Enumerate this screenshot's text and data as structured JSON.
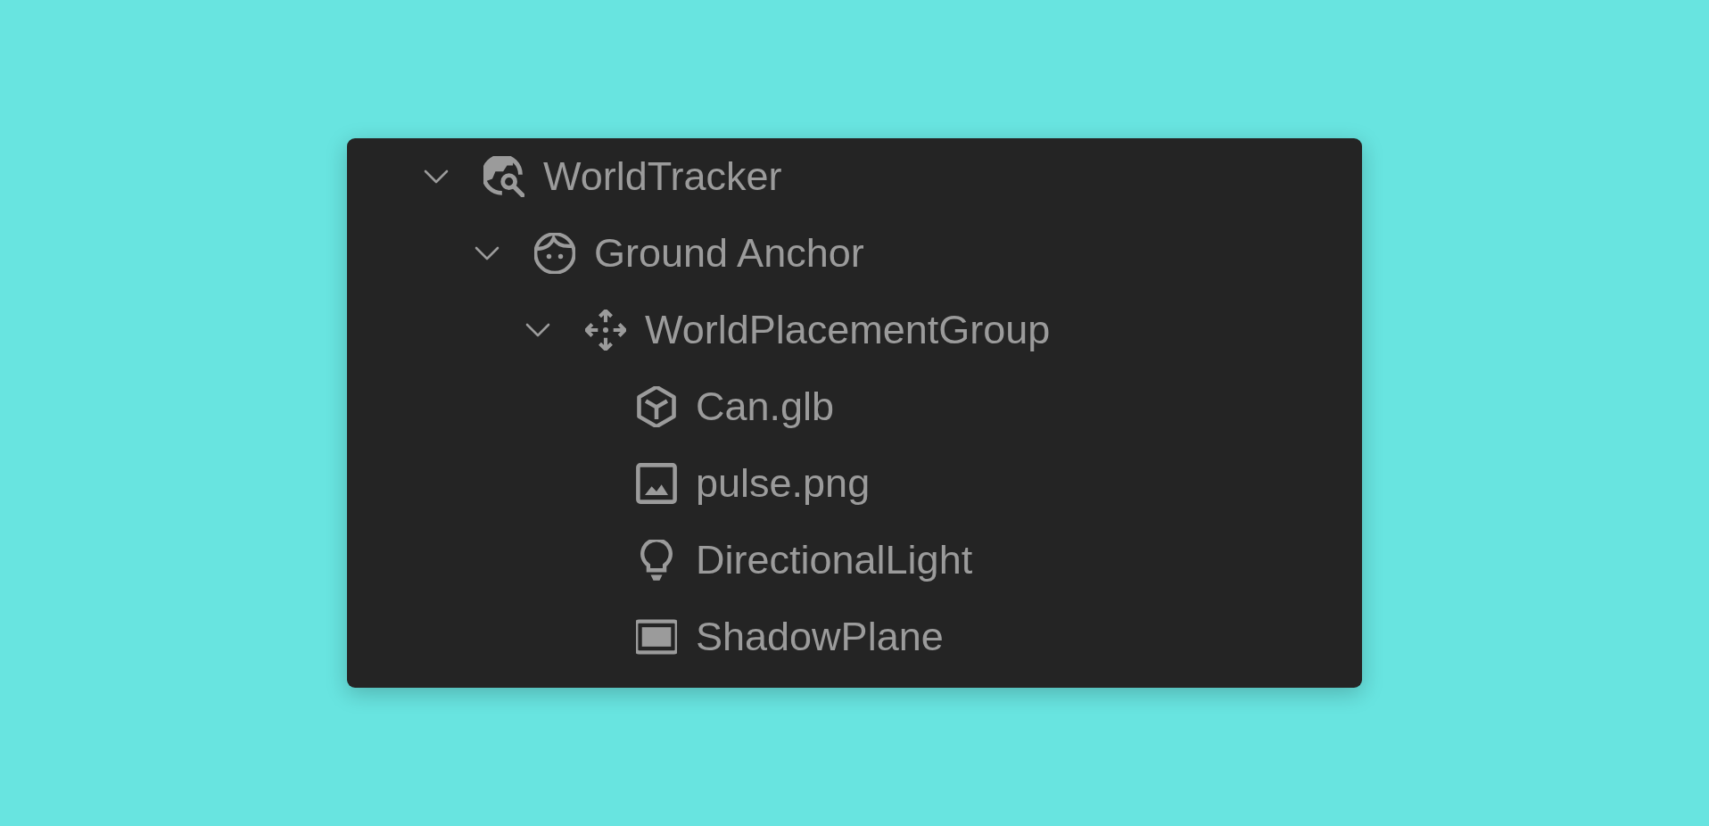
{
  "tree": [
    {
      "label": "WorldTracker",
      "kind": "tracker",
      "expanded": true,
      "children": [
        {
          "label": "Ground Anchor",
          "kind": "anchor",
          "expanded": true,
          "children": [
            {
              "label": "WorldPlacementGroup",
              "kind": "group",
              "expanded": true,
              "children": [
                {
                  "label": "Can.glb",
                  "kind": "model"
                },
                {
                  "label": "pulse.png",
                  "kind": "image"
                },
                {
                  "label": "DirectionalLight",
                  "kind": "light"
                },
                {
                  "label": "ShadowPlane",
                  "kind": "plane"
                }
              ]
            }
          ]
        }
      ]
    }
  ]
}
